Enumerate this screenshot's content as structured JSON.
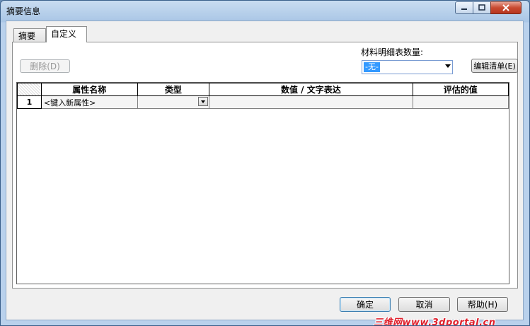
{
  "window": {
    "title": "摘要信息"
  },
  "tabs": [
    {
      "label": "摘要"
    },
    {
      "label": "自定义"
    }
  ],
  "toolbar": {
    "delete_label": "删除(D)",
    "material_qty_label": "材料明细表数量:",
    "material_qty_value": "-无-",
    "edit_list_label": "编辑清单(E)"
  },
  "grid": {
    "columns": [
      "属性名称",
      "类型",
      "数值 / 文字表达",
      "评估的值"
    ],
    "rows": [
      {
        "num": "1",
        "name": "<键入新属性>",
        "type": "",
        "value": "",
        "evaluated": ""
      }
    ]
  },
  "footer": {
    "ok_label": "确定",
    "cancel_label": "取消",
    "help_label": "帮助(H)"
  },
  "watermark": "三维网www.3dportal.cn",
  "colors": {
    "selection": "#3399ff",
    "watermark": "#e0202c"
  }
}
